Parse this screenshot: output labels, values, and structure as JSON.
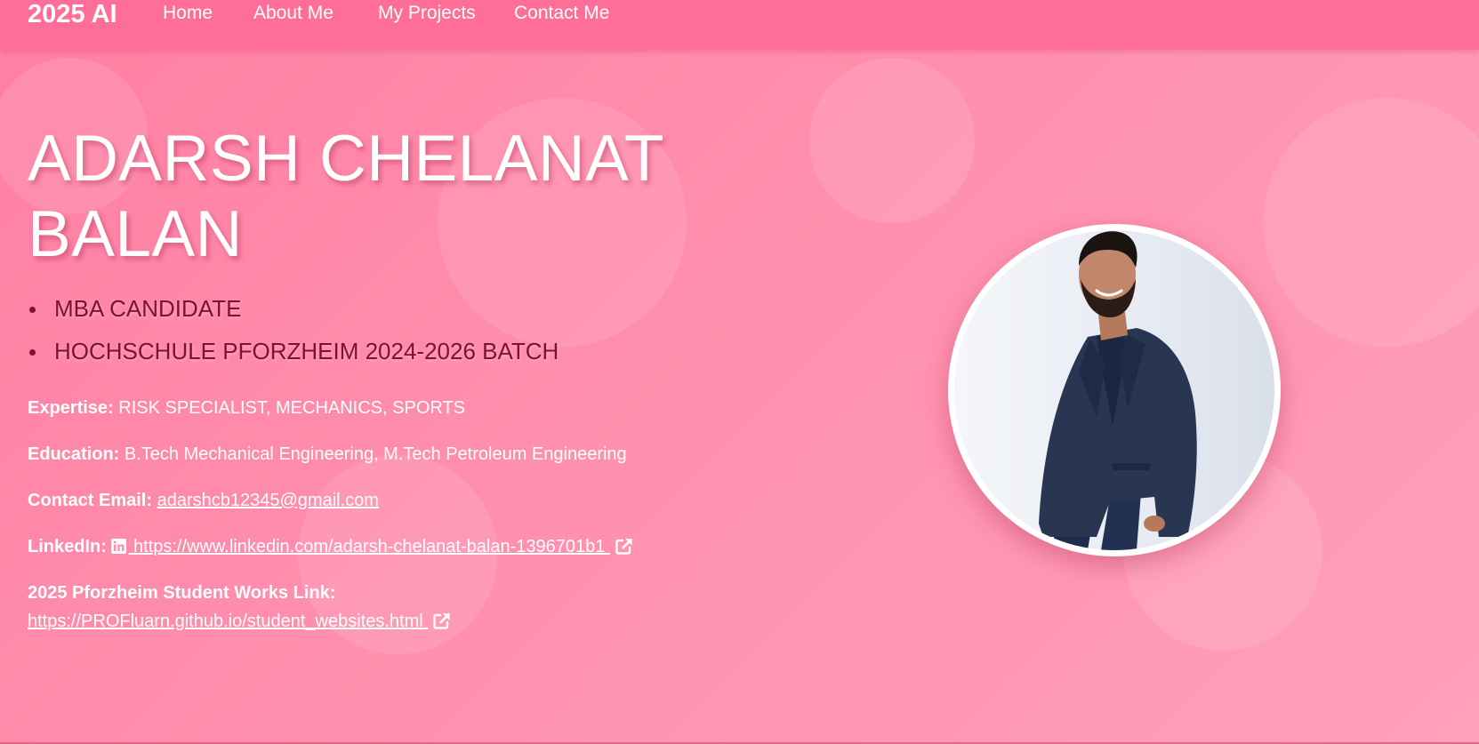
{
  "nav": {
    "brand": "2025 AI",
    "links": [
      "Home",
      "About Me",
      "My Projects",
      "Contact Me"
    ]
  },
  "hero": {
    "name_line1": "ADARSH CHELANAT",
    "name_line2": "BALAN",
    "roles": [
      "MBA CANDIDATE",
      "HOCHSCHULE PFORZHEIM 2024-2026 BATCH"
    ]
  },
  "details": {
    "expertise_label": "Expertise:",
    "expertise_value": "RISK SPECIALIST, MECHANICS, SPORTS",
    "education_label": "Education:",
    "education_value": "B.Tech Mechanical Engineering, M.Tech Petroleum Engineering",
    "email_label": "Contact Email:",
    "email_value": "adarshcb12345@gmail.com",
    "linkedin_label": "LinkedIn:",
    "linkedin_url": " https://www.linkedin.com/adarsh-chelanat-balan-1396701b1 ",
    "works_label": "2025 Pforzheim Student Works Link:",
    "works_url": "https://PROFluarn.github.io/student_websites.html "
  },
  "icons": {
    "linkedin": "linkedin-icon",
    "external": "external-link-icon"
  },
  "colors": {
    "nav_bg": "#ff6d99",
    "page_bg": "#ff8fae",
    "role_text": "#7a1233",
    "text": "#ffffff"
  }
}
